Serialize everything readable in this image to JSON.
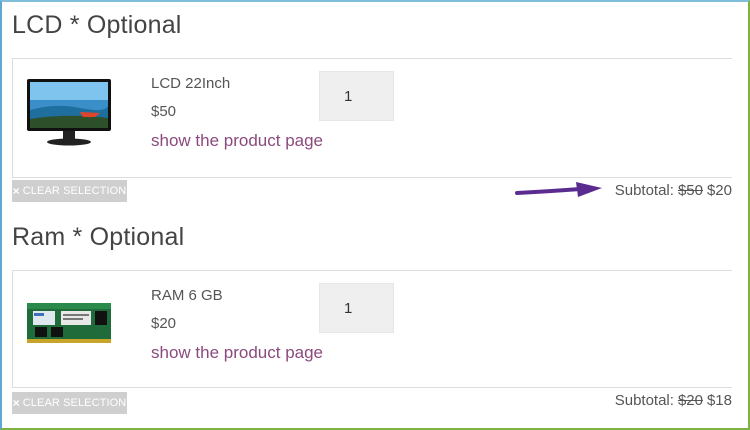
{
  "sections": [
    {
      "title": "LCD * Optional",
      "product": {
        "name": "LCD 22Inch",
        "price": "$50",
        "link": "show the product page",
        "quantity": "1"
      },
      "clear_label": "CLEAR SELECTION",
      "clear_icon": "×",
      "subtotal_label": "Subtotal:",
      "subtotal_old": "$50",
      "subtotal_new": "$20"
    },
    {
      "title": "Ram * Optional",
      "product": {
        "name": "RAM 6 GB",
        "price": "$20",
        "link": "show the product page",
        "quantity": "1"
      },
      "clear_label": "CLEAR SELECTION",
      "clear_icon": "×",
      "subtotal_label": "Subtotal:",
      "subtotal_old": "$20",
      "subtotal_new": "$18"
    }
  ],
  "annotation": {
    "icon": "arrow-right-icon",
    "color": "#5b2c8f"
  },
  "colors": {
    "link": "#8a4a7e",
    "clear_button": "#cfcfcf",
    "border": "#dddddd"
  }
}
